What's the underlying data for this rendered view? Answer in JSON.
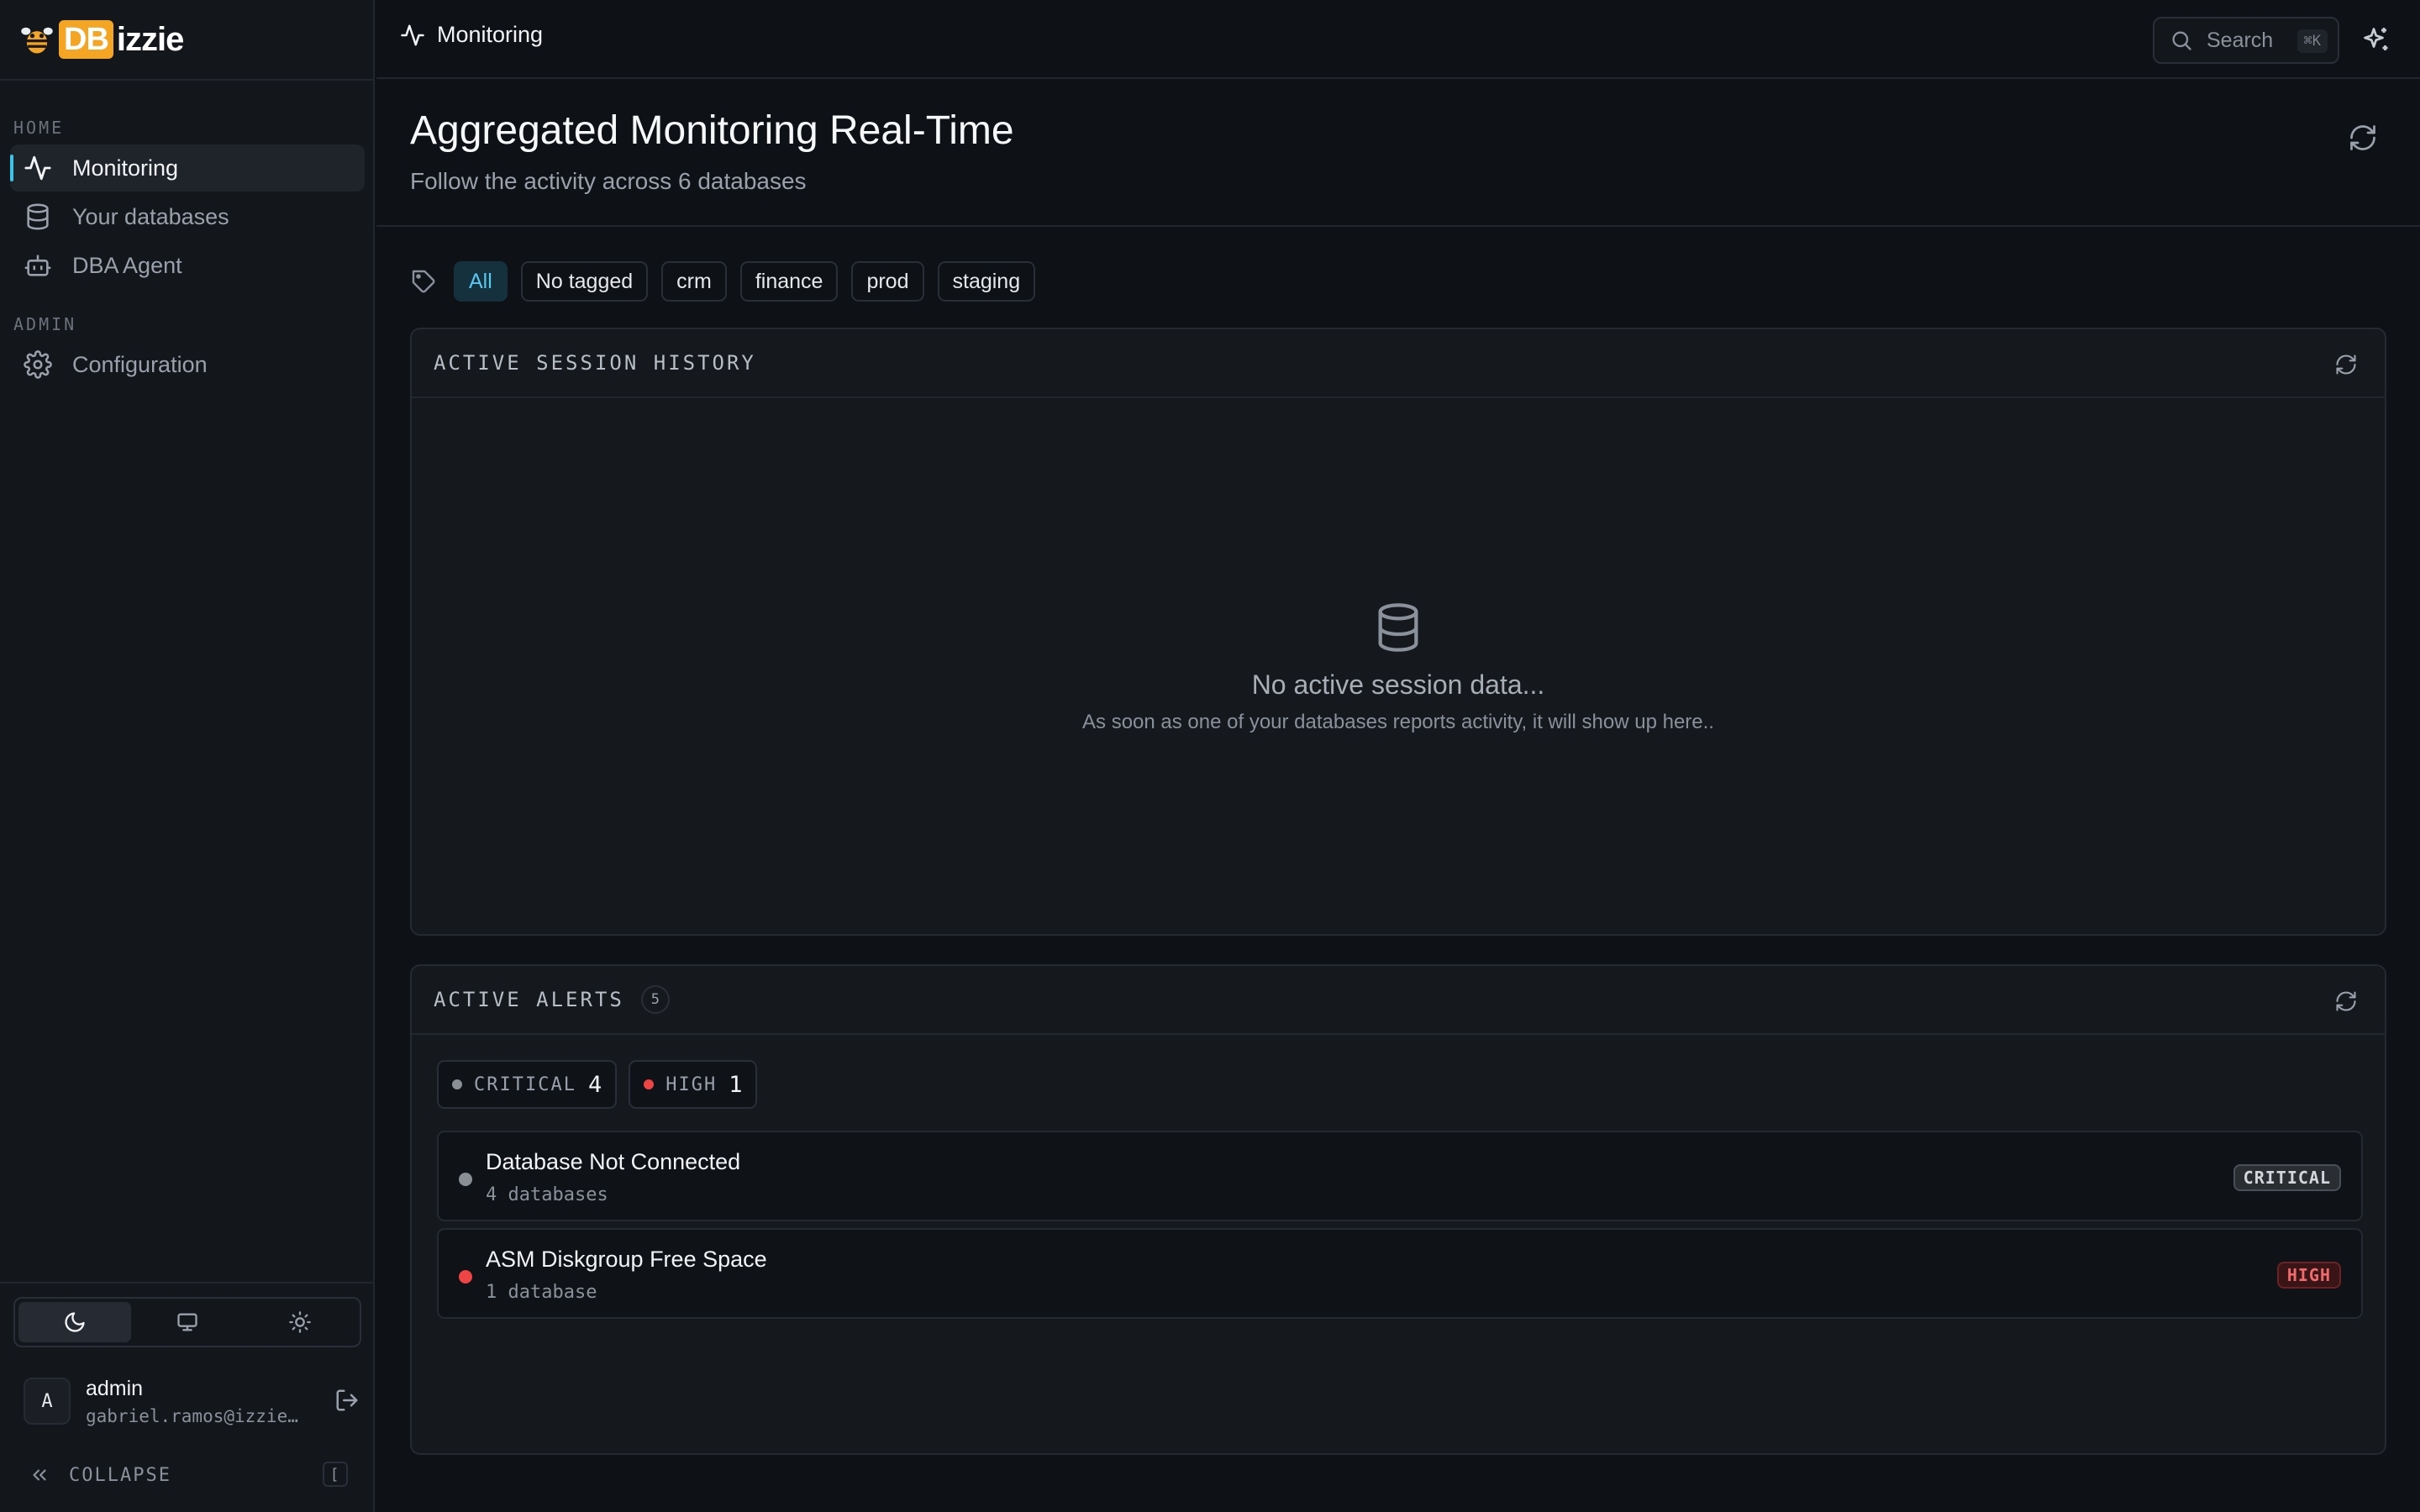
{
  "app": {
    "logo_badge": "DB",
    "logo_rest": "izzie"
  },
  "sidebar": {
    "sections": {
      "home": "HOME",
      "admin": "ADMIN"
    },
    "items": [
      {
        "label": "Monitoring",
        "icon": "activity-icon",
        "active": true
      },
      {
        "label": "Your databases",
        "icon": "database-icon"
      },
      {
        "label": "DBA Agent",
        "icon": "bot-icon"
      },
      {
        "label": "Configuration",
        "icon": "gear-icon"
      }
    ],
    "theme": [
      "moon-icon",
      "monitor-icon",
      "sun-icon"
    ],
    "user": {
      "initial": "A",
      "name": "admin",
      "email": "gabriel.ramos@izzie…"
    },
    "collapse_label": "COLLAPSE",
    "collapse_key": "["
  },
  "topbar": {
    "breadcrumb": "Monitoring",
    "search_placeholder": "Search",
    "search_shortcut": "⌘K"
  },
  "header": {
    "title": "Aggregated Monitoring Real-Time",
    "subtitle": "Follow the activity across 6 databases"
  },
  "filters": [
    "All",
    "No tagged",
    "crm",
    "finance",
    "prod",
    "staging"
  ],
  "session_panel": {
    "title": "ACTIVE SESSION HISTORY",
    "empty_title": "No active session data...",
    "empty_desc": "As soon as one of your databases reports activity, it will show up here.."
  },
  "alerts_panel": {
    "title": "ACTIVE ALERTS",
    "count": "5",
    "severity": [
      {
        "label": "CRITICAL",
        "count": "4",
        "color": "#8a8f96"
      },
      {
        "label": "HIGH",
        "count": "1",
        "color": "#ef4444"
      }
    ],
    "alerts": [
      {
        "title": "Database Not Connected",
        "sub": "4 databases",
        "badge": "CRITICAL",
        "color": "#8a8f96"
      },
      {
        "title": "ASM Diskgroup Free Space",
        "sub": "1 database",
        "badge": "HIGH",
        "color": "#ef4444"
      }
    ]
  },
  "colors": {
    "accent": "#3ec3e8",
    "critical": "#8a8f96",
    "high": "#ef4444",
    "logo": "#f5a524"
  }
}
